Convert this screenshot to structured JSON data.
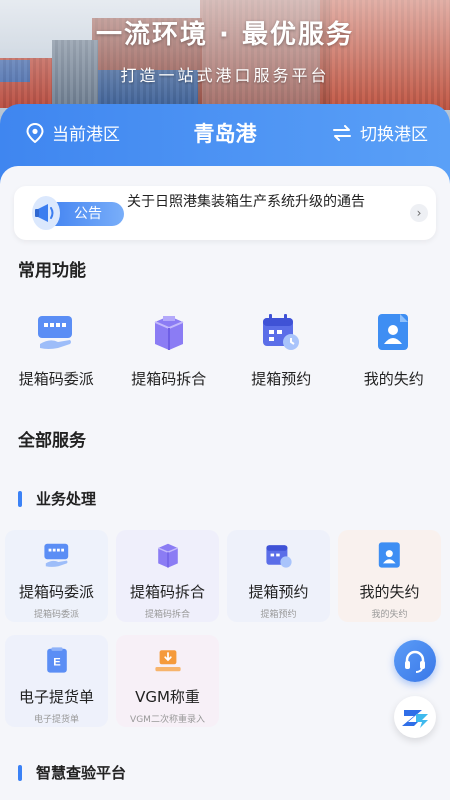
{
  "hero": {
    "title": "一流环境 · 最优服务",
    "subtitle": "打造一站式港口服务平台"
  },
  "port_bar": {
    "current_label": "当前港区",
    "port_name": "青岛港",
    "switch_label": "切换港区"
  },
  "notice": {
    "badge": "公告",
    "text": "关于日照港集装箱生产系统升级的通告"
  },
  "common_functions": {
    "title": "常用功能",
    "items": [
      {
        "label": "提箱码委派",
        "icon": "container-code-assign-icon"
      },
      {
        "label": "提箱码拆合",
        "icon": "container-code-split-icon"
      },
      {
        "label": "提箱预约",
        "icon": "calendar-booking-icon"
      },
      {
        "label": "我的失约",
        "icon": "user-document-icon"
      }
    ]
  },
  "all_services": {
    "title": "全部服务",
    "business": {
      "title": "业务处理",
      "items": [
        {
          "label": "提箱码委派",
          "sub": "提箱码委派"
        },
        {
          "label": "提箱码拆合",
          "sub": "提箱码拆合"
        },
        {
          "label": "提箱预约",
          "sub": "提箱预约"
        },
        {
          "label": "我的失约",
          "sub": "我的失约"
        },
        {
          "label": "电子提货单",
          "sub": "电子提货单"
        },
        {
          "label": "VGM称重",
          "sub": "VGM二次称重录入"
        }
      ]
    },
    "inspection": {
      "title": "智慧查验平台"
    }
  },
  "colors": {
    "accent": "#3f86f0",
    "page_bg": "#f5f6fa"
  }
}
